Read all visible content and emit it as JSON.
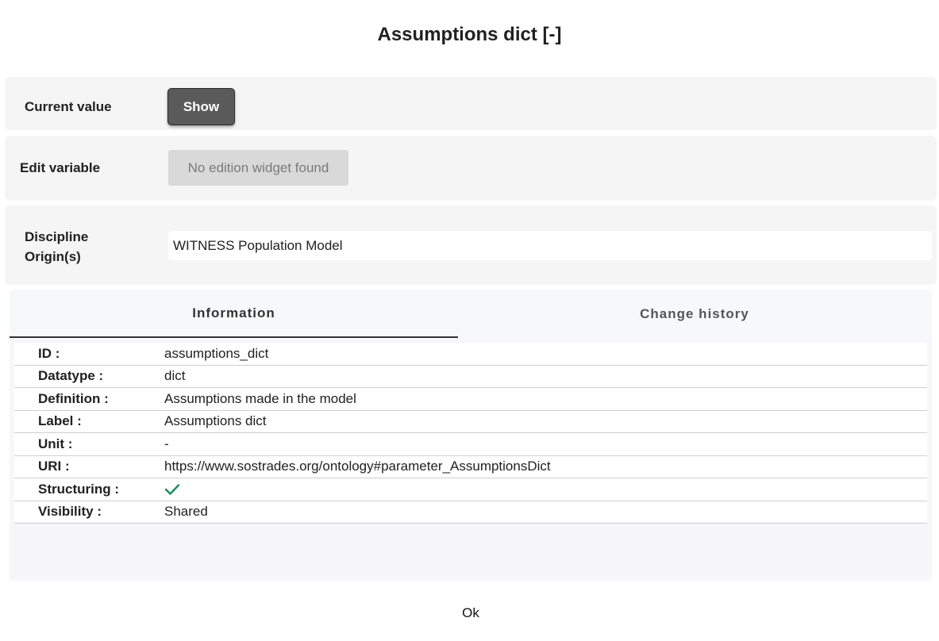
{
  "dialog": {
    "title": "Assumptions dict [-]"
  },
  "current_value": {
    "label": "Current value",
    "show_button": "Show"
  },
  "edit_variable": {
    "label": "Edit variable",
    "widget_message": "No edition widget found"
  },
  "discipline": {
    "label": "Discipline Origin(s)",
    "value": "WITNESS Population Model"
  },
  "tabs": [
    {
      "label": "Information",
      "active": true
    },
    {
      "label": "Change history",
      "active": false
    }
  ],
  "info": {
    "rows": [
      {
        "key": "ID :",
        "value": "assumptions_dict"
      },
      {
        "key": "Datatype :",
        "value": "dict"
      },
      {
        "key": "Definition :",
        "value": "Assumptions made in the model"
      },
      {
        "key": "Label :",
        "value": "Assumptions dict"
      },
      {
        "key": "Unit :",
        "value": "-"
      },
      {
        "key": "URI :",
        "value": "https://www.sostrades.org/ontology#parameter_AssumptionsDict"
      },
      {
        "key": "Structuring :",
        "value": "",
        "icon": "check-icon",
        "icon_color": "#1b8a5a"
      },
      {
        "key": "Visibility :",
        "value": "Shared"
      }
    ]
  },
  "footer": {
    "ok_label": "Ok"
  }
}
